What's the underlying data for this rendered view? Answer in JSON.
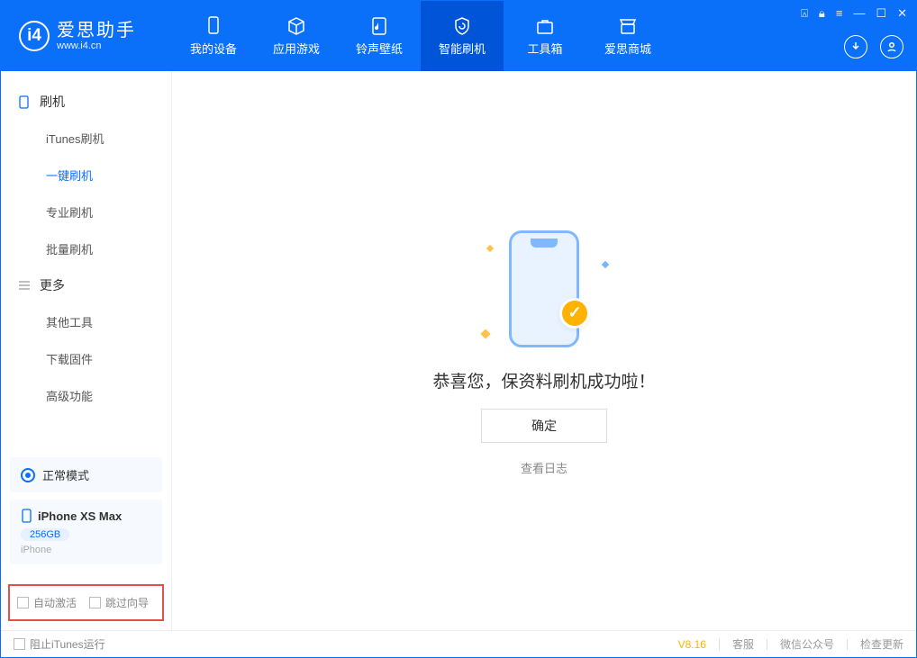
{
  "header": {
    "app_name_cn": "爱思助手",
    "app_url": "www.i4.cn",
    "nav": [
      {
        "label": "我的设备"
      },
      {
        "label": "应用游戏"
      },
      {
        "label": "铃声壁纸"
      },
      {
        "label": "智能刷机",
        "active": true
      },
      {
        "label": "工具箱"
      },
      {
        "label": "爱思商城"
      }
    ]
  },
  "sidebar": {
    "section_flash": "刷机",
    "items_flash": [
      {
        "label": "iTunes刷机"
      },
      {
        "label": "一键刷机",
        "active": true
      },
      {
        "label": "专业刷机"
      },
      {
        "label": "批量刷机"
      }
    ],
    "section_more": "更多",
    "items_more": [
      {
        "label": "其他工具"
      },
      {
        "label": "下载固件"
      },
      {
        "label": "高级功能"
      }
    ],
    "status_mode": "正常模式",
    "device_name": "iPhone XS Max",
    "device_capacity": "256GB",
    "device_type": "iPhone",
    "chk_auto_activate": "自动激活",
    "chk_skip_guide": "跳过向导"
  },
  "main": {
    "success_text": "恭喜您，保资料刷机成功啦！",
    "ok_button": "确定",
    "view_log": "查看日志"
  },
  "footer": {
    "stop_itunes": "阻止iTunes运行",
    "version": "V8.16",
    "customer_service": "客服",
    "wechat": "微信公众号",
    "check_update": "检查更新"
  }
}
